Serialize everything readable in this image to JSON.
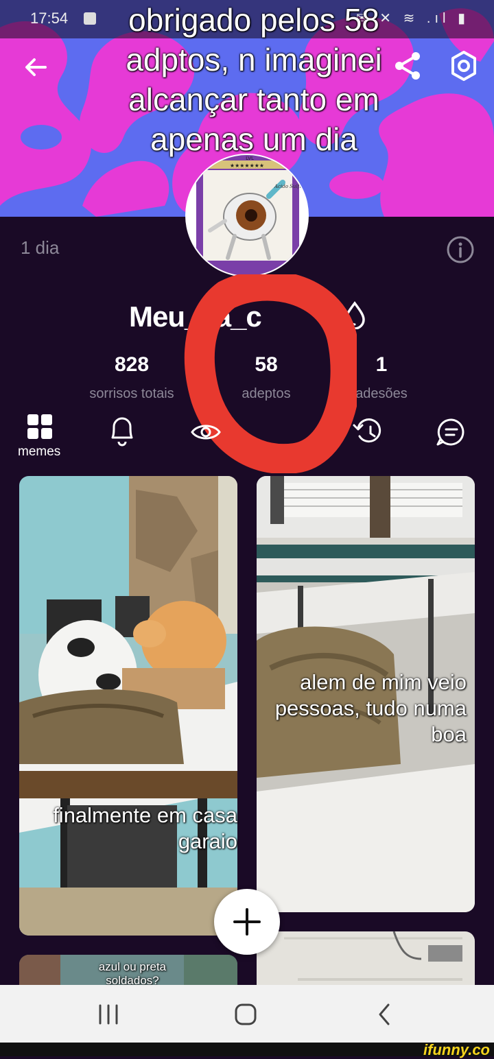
{
  "status_bar": {
    "time": "17:54",
    "icons": "✉ ✕ ≋ .ıl ▮"
  },
  "header": {
    "caption": "obrigado pelos 58\nadptos, n imaginei\nalcançar tanto em\napenas um dia"
  },
  "profile": {
    "age": "1 dia",
    "username": "Meu__a_c",
    "stats": [
      {
        "value": "828",
        "label": "sorrisos totais"
      },
      {
        "value": "58",
        "label": "adeptos"
      },
      {
        "value": "1",
        "label": "adesões"
      }
    ]
  },
  "tabs": {
    "memes_label": "memes"
  },
  "avatar": {
    "card_text": "LVL",
    "card_stars": "★★★★★★★",
    "card_name": "Acido Sulfurico"
  },
  "posts": [
    {
      "caption": "finalmente em casa\ngaraio"
    },
    {
      "caption": "alem de mim veio\npessoas, tudo numa\nboa"
    },
    {
      "caption": "azul ou preta\nsoldados?"
    }
  ],
  "watermark": "ifunny.co",
  "colors": {
    "background": "#1a0a26",
    "accent": "#e8392f",
    "cover_magenta": "#e83ad8",
    "cover_blue": "#5b6bf2"
  }
}
